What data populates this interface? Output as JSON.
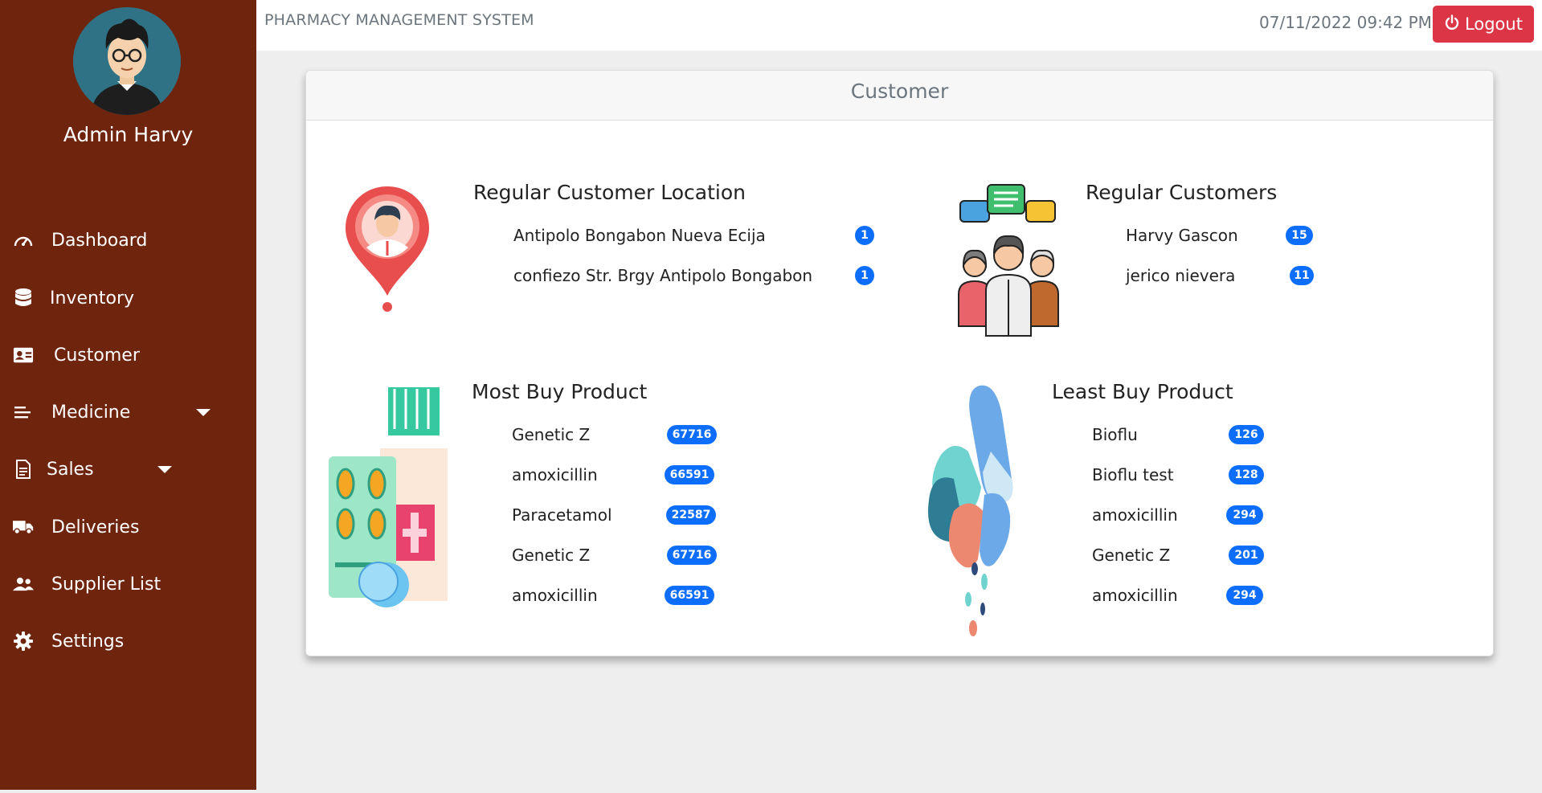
{
  "app": {
    "title": "PHARMACY MANAGEMENT SYSTEM"
  },
  "header": {
    "datetime": "07/11/2022 09:42 PM",
    "logout_label": "Logout"
  },
  "user": {
    "name": "Admin Harvy"
  },
  "sidebar": {
    "items": [
      {
        "label": "Dashboard",
        "icon": "dashboard-icon"
      },
      {
        "label": "Inventory",
        "icon": "database-icon"
      },
      {
        "label": "Customer",
        "icon": "id-card-icon"
      },
      {
        "label": "Medicine",
        "icon": "list-icon",
        "dropdown": true
      },
      {
        "label": "Sales",
        "icon": "file-icon",
        "dropdown": true
      },
      {
        "label": "Deliveries",
        "icon": "truck-icon"
      },
      {
        "label": "Supplier List",
        "icon": "users-icon"
      },
      {
        "label": "Settings",
        "icon": "gear-icon"
      }
    ]
  },
  "card": {
    "title": "Customer",
    "sections": {
      "location": {
        "title": "Regular Customer Location",
        "rows": [
          {
            "label": "Antipolo Bongabon Nueva Ecija",
            "badge": "1"
          },
          {
            "label": "confiezo Str. Brgy Antipolo Bongabon",
            "badge": "1"
          }
        ]
      },
      "customers": {
        "title": "Regular Customers",
        "rows": [
          {
            "label": "Harvy Gascon",
            "badge": "15"
          },
          {
            "label": "jerico nievera",
            "badge": "11"
          }
        ]
      },
      "most": {
        "title": "Most Buy Product",
        "rows": [
          {
            "label": "Genetic Z",
            "badge": "67716"
          },
          {
            "label": "amoxicillin",
            "badge": "66591"
          },
          {
            "label": "Paracetamol",
            "badge": "22587"
          },
          {
            "label": "Genetic Z",
            "badge": "67716"
          },
          {
            "label": "amoxicillin",
            "badge": "66591"
          }
        ]
      },
      "least": {
        "title": "Least Buy Product",
        "rows": [
          {
            "label": "Bioflu",
            "badge": "126"
          },
          {
            "label": "Bioflu test",
            "badge": "128"
          },
          {
            "label": "amoxicillin",
            "badge": "294"
          },
          {
            "label": "Genetic Z",
            "badge": "201"
          },
          {
            "label": "amoxicillin",
            "badge": "294"
          }
        ]
      }
    }
  },
  "colors": {
    "sidebar": "#6f240e",
    "badge": "#0d6efd",
    "logout": "#dc3545"
  }
}
